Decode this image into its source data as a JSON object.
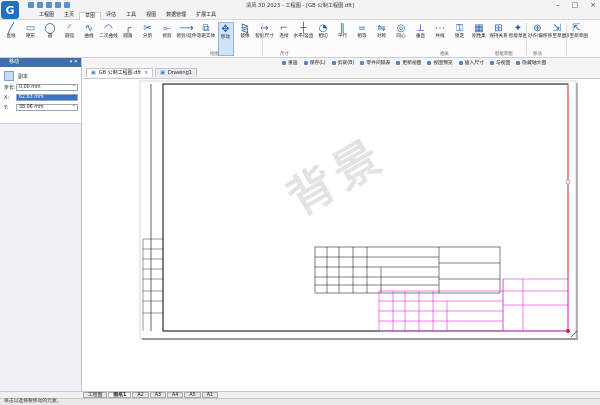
{
  "app": {
    "title": "清风 3D 2023 - 工程图 - [GB 公制工程图.dft]",
    "logo_letter": "G"
  },
  "menu": [
    "工程图",
    "主页",
    "草图",
    "评估",
    "工具",
    "视图",
    "数据管理",
    "扩展工具"
  ],
  "menu_active_index": 2,
  "ribbon": {
    "buttons": [
      {
        "label": "直线",
        "icon": "line-icon"
      },
      {
        "label": "矩形",
        "icon": "rectangle-icon"
      },
      {
        "label": "圆",
        "icon": "circle-icon"
      },
      {
        "label": "圆弧",
        "icon": "arc-icon"
      },
      {
        "label": "曲线",
        "icon": "curve-icon"
      },
      {
        "label": "二次曲线",
        "icon": "conic-icon"
      },
      {
        "label": "圆角",
        "icon": "fillet-icon"
      },
      {
        "label": "分割",
        "icon": "split-icon"
      },
      {
        "label": "修剪",
        "icon": "trim-icon"
      },
      {
        "label": "修剪/延伸",
        "icon": "extend-icon"
      },
      {
        "label": "等距实体",
        "icon": "offset-icon"
      },
      {
        "label": "移动",
        "icon": "move-icon"
      },
      {
        "label": "镜像",
        "icon": "mirror-icon"
      },
      {
        "label": "智能尺寸",
        "icon": "dimension-icon"
      },
      {
        "label": "连接",
        "icon": "connect-icon"
      },
      {
        "label": "水平/竖直",
        "icon": "horizontal-icon"
      },
      {
        "label": "相切",
        "icon": "tangent-icon"
      },
      {
        "label": "平行",
        "icon": "parallel-icon"
      },
      {
        "label": "相等",
        "icon": "equal-icon"
      },
      {
        "label": "对称",
        "icon": "symmetric-icon"
      },
      {
        "label": "同心",
        "icon": "concentric-icon"
      },
      {
        "label": "垂直",
        "icon": "perpendicular-icon"
      },
      {
        "label": "共线",
        "icon": "collinear-icon"
      },
      {
        "label": "锁定",
        "icon": "lock-icon"
      },
      {
        "label": "刚性集",
        "icon": "rigid-icon"
      },
      {
        "label": "保持关系",
        "icon": "keep-icon"
      },
      {
        "label": "智能草图",
        "icon": "smart-sketch-icon"
      },
      {
        "label": "对齐/偏移",
        "icon": "align-icon"
      },
      {
        "label": "移至草图",
        "icon": "to-sketch-icon"
      },
      {
        "label": "移至新草图",
        "icon": "to-new-sketch-icon"
      }
    ],
    "group_labels": [
      "绘图",
      "尺寸",
      "相关",
      "智能草图",
      "移动"
    ]
  },
  "panel": {
    "header": "移动",
    "title": "副本",
    "fields": [
      {
        "label": "步长:",
        "value": "0.00 mm"
      },
      {
        "label": "X:",
        "value": "62.63 mm"
      },
      {
        "label": "Y:",
        "value": "38.06 mm"
      }
    ]
  },
  "toolbar2": [
    "重画",
    "保存(L)",
    "剪裁(B)",
    "零件间隔表",
    "更新视图",
    "视图预览",
    "插入尺寸",
    "与视图",
    "隐藏轴大图"
  ],
  "tabs": [
    {
      "label": "GB 公制工程图.dft",
      "close": "×"
    },
    {
      "label": "Drawing1",
      "close": ""
    }
  ],
  "sheet_tabs": [
    "工程图",
    "图纸1",
    "A2",
    "A3",
    "A4",
    "A5",
    "A1"
  ],
  "sheet_active_index": 1,
  "status": "单击以选择要移动的元素。",
  "watermark": "背景",
  "colors": {
    "accent": "#3f6fae",
    "magenta": "#e000e0",
    "red": "#d81e1e",
    "selection": "#cfe2f7"
  }
}
